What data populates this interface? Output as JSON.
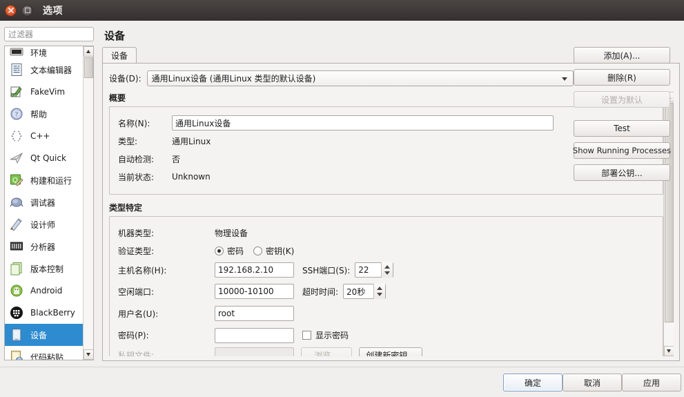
{
  "window": {
    "title": "选项",
    "close_icon": "close-icon",
    "maximize_icon": "maximize-icon"
  },
  "sidebar": {
    "filter_placeholder": "过滤器",
    "filter_value": "",
    "items": [
      {
        "label": "环境",
        "icon": "environment-icon",
        "selected": false,
        "partial": true
      },
      {
        "label": "文本编辑器",
        "icon": "text-editor-icon",
        "selected": false
      },
      {
        "label": "FakeVim",
        "icon": "fakevim-icon",
        "selected": false
      },
      {
        "label": "帮助",
        "icon": "help-icon",
        "selected": false
      },
      {
        "label": "C++",
        "icon": "cpp-icon",
        "selected": false
      },
      {
        "label": "Qt Quick",
        "icon": "qtquick-icon",
        "selected": false
      },
      {
        "label": "构建和运行",
        "icon": "build-run-icon",
        "selected": false
      },
      {
        "label": "调试器",
        "icon": "debugger-icon",
        "selected": false
      },
      {
        "label": "设计师",
        "icon": "designer-icon",
        "selected": false
      },
      {
        "label": "分析器",
        "icon": "analyzer-icon",
        "selected": false
      },
      {
        "label": "版本控制",
        "icon": "version-control-icon",
        "selected": false
      },
      {
        "label": "Android",
        "icon": "android-icon",
        "selected": false
      },
      {
        "label": "BlackBerry",
        "icon": "blackberry-icon",
        "selected": false
      },
      {
        "label": "设备",
        "icon": "device-icon",
        "selected": true
      },
      {
        "label": "代码粘贴",
        "icon": "code-paste-icon",
        "selected": false
      }
    ],
    "selected_bg": "#2e8bd0",
    "selected_fg": "#ffffff"
  },
  "page": {
    "title": "设备",
    "tabs": [
      {
        "label": "设备",
        "active": true
      }
    ]
  },
  "device_selector": {
    "label": "设备(D):",
    "value": "通用Linux设备 (通用Linux 类型的默认设备)",
    "dropdown_icon": "chevron-down-icon"
  },
  "overview": {
    "title": "概要",
    "name_label": "名称(N):",
    "name_value": "通用Linux设备",
    "rows": [
      {
        "key": "类型:",
        "value": "通用Linux"
      },
      {
        "key": "自动检测:",
        "value": "否"
      },
      {
        "key": "当前状态:",
        "value": "Unknown"
      }
    ]
  },
  "type_specific": {
    "title": "类型特定",
    "machine_type_label": "机器类型:",
    "machine_type_value": "物理设备",
    "auth_type_label": "验证类型:",
    "auth_options": [
      {
        "label": "密码",
        "checked": true
      },
      {
        "label": "密钥(K)",
        "checked": false
      }
    ],
    "host_label": "主机名称(H):",
    "host_value": "192.168.2.10",
    "ssh_port_label": "SSH端口(S):",
    "ssh_port_value": "22",
    "free_ports_label": "空闲端口:",
    "free_ports_value": "10000-10100",
    "timeout_label": "超时时间:",
    "timeout_value": "20秒",
    "username_label": "用户名(U):",
    "username_value": "root",
    "password_label": "密码(P):",
    "password_value": "",
    "show_password_label": "显示密码",
    "show_password_checked": false,
    "private_key_label": "私钥文件:",
    "private_key_value": "",
    "browse_label": "浏览...",
    "create_key_label": "创建新密钥..."
  },
  "side_buttons": [
    {
      "label": "添加(A)...",
      "name": "add-button",
      "disabled": false
    },
    {
      "label": "删除(R)",
      "name": "remove-button",
      "disabled": false
    },
    {
      "label": "设置为默认",
      "name": "set-default-button",
      "disabled": true
    },
    {
      "label": "Test",
      "name": "test-button",
      "disabled": false
    },
    {
      "label": "Show Running Processes",
      "name": "show-running-processes-button",
      "disabled": false
    },
    {
      "label": "部署公钥...",
      "name": "deploy-public-key-button",
      "disabled": false
    }
  ],
  "dialog_buttons": {
    "ok": "确定",
    "cancel": "取消",
    "apply": "应用"
  }
}
